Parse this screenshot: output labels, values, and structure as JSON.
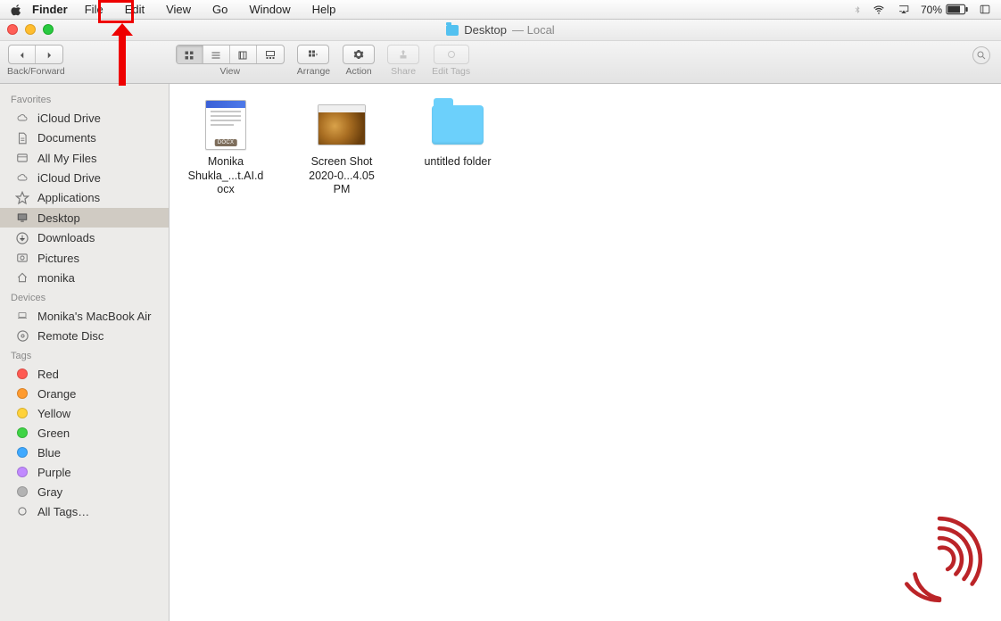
{
  "menubar": {
    "app_name": "Finder",
    "items": [
      "File",
      "Edit",
      "View",
      "Go",
      "Window",
      "Help"
    ],
    "battery_pct": "70%"
  },
  "titlebar": {
    "title_left": "Desktop",
    "title_right": "— Local"
  },
  "toolbar": {
    "back_forward_label": "Back/Forward",
    "view_label": "View",
    "arrange_label": "Arrange",
    "action_label": "Action",
    "share_label": "Share",
    "edit_tags_label": "Edit Tags"
  },
  "sidebar": {
    "sections": [
      {
        "head": "Favorites",
        "items": [
          {
            "icon": "cloud",
            "label": "iCloud Drive"
          },
          {
            "icon": "doc",
            "label": "Documents"
          },
          {
            "icon": "all",
            "label": "All My Files"
          },
          {
            "icon": "cloud",
            "label": "iCloud Drive"
          },
          {
            "icon": "apps",
            "label": "Applications"
          },
          {
            "icon": "desktop",
            "label": "Desktop",
            "selected": true
          },
          {
            "icon": "download",
            "label": "Downloads"
          },
          {
            "icon": "pictures",
            "label": "Pictures"
          },
          {
            "icon": "home",
            "label": "monika"
          }
        ]
      },
      {
        "head": "Devices",
        "items": [
          {
            "icon": "laptop",
            "label": "Monika's MacBook Air"
          },
          {
            "icon": "disc",
            "label": "Remote Disc"
          }
        ]
      },
      {
        "head": "Tags",
        "items": [
          {
            "tag": "#ff5a52",
            "label": "Red"
          },
          {
            "tag": "#ff9b2f",
            "label": "Orange"
          },
          {
            "tag": "#ffd23a",
            "label": "Yellow"
          },
          {
            "tag": "#3fd445",
            "label": "Green"
          },
          {
            "tag": "#3fa9ff",
            "label": "Blue"
          },
          {
            "tag": "#c18aff",
            "label": "Purple"
          },
          {
            "tag": "#b3b3b3",
            "label": "Gray"
          },
          {
            "icon": "alltags",
            "label": "All Tags…"
          }
        ]
      }
    ]
  },
  "files": [
    {
      "kind": "docx",
      "line1": "Monika",
      "line2": "Shukla_...t.AI.docx"
    },
    {
      "kind": "screenshot",
      "line1": "Screen Shot",
      "line2": "2020-0...4.05 PM"
    },
    {
      "kind": "folder",
      "line1": "untitled folder",
      "line2": ""
    }
  ],
  "annotations": {
    "highlight_menu": "File"
  }
}
